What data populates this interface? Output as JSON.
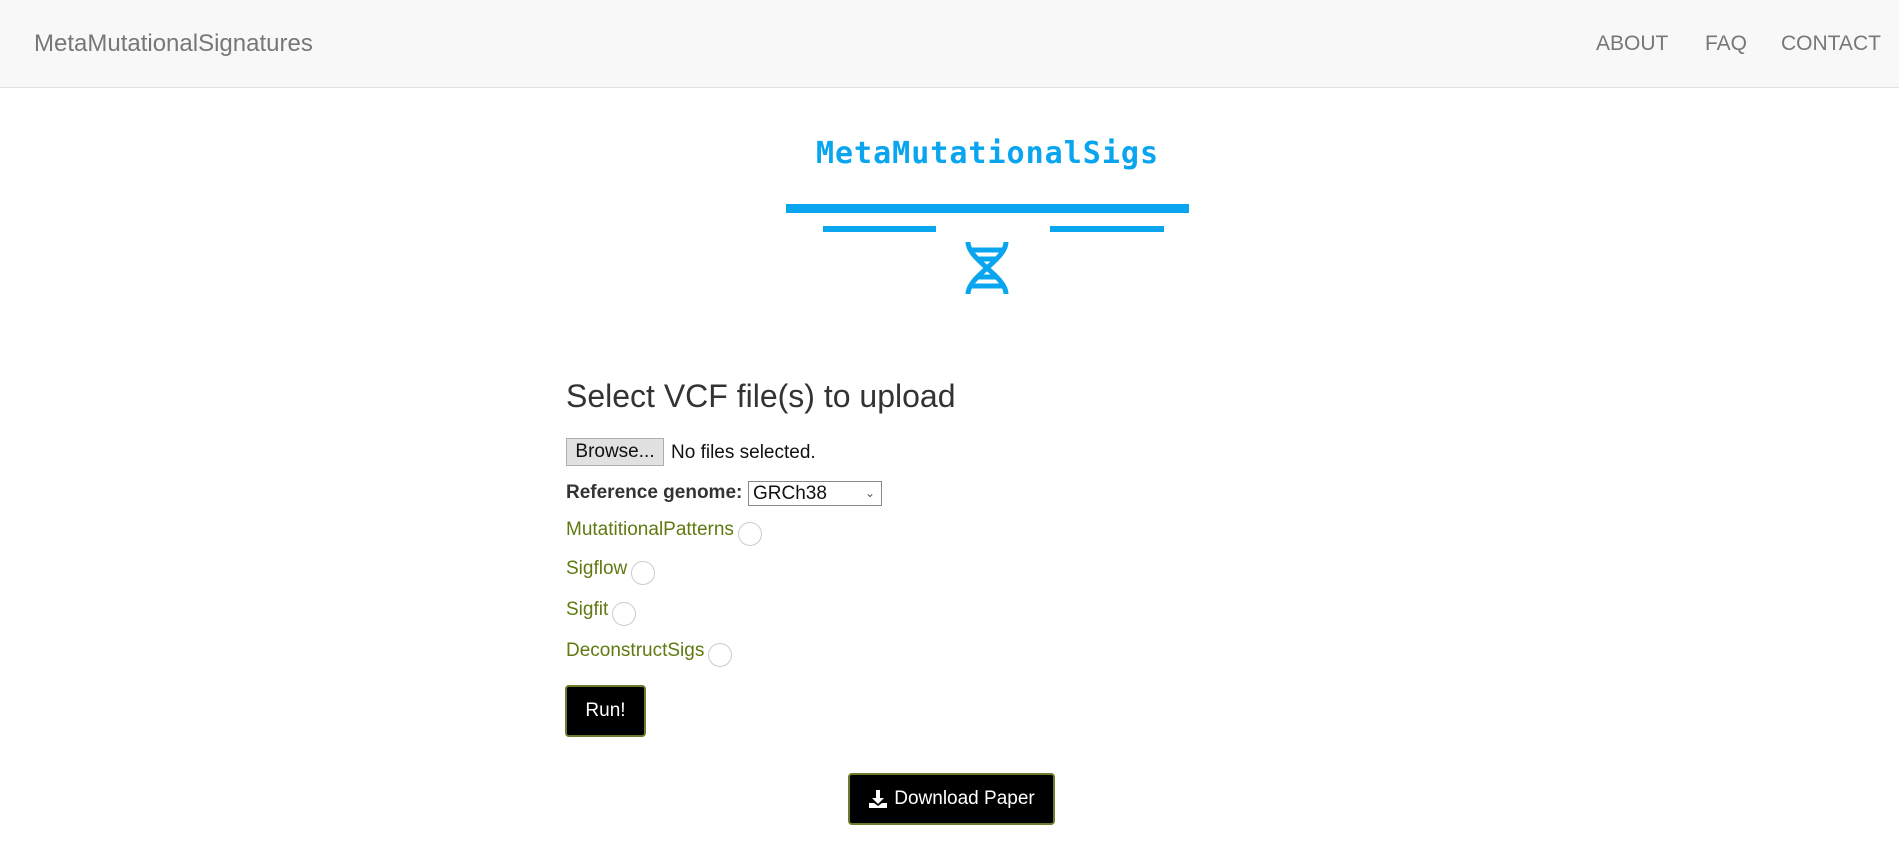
{
  "navbar": {
    "brand": "MetaMutationalSignatures",
    "links": [
      "ABOUT",
      "FAQ",
      "CONTACT"
    ]
  },
  "logo": {
    "text": "MetaMutationalSigs",
    "icon": "dna-icon",
    "color": "#0aa5ef"
  },
  "form": {
    "heading": "Select VCF file(s) to upload",
    "browse_label": "Browse...",
    "file_status": "No files selected.",
    "reference_label": "Reference genome:",
    "reference_value": "GRCh38",
    "tools": [
      "MutatitionalPatterns",
      "Sigflow",
      "Sigfit",
      "DeconstructSigs"
    ],
    "run_label": "Run!"
  },
  "download": {
    "label": "Download Paper",
    "icon": "download-icon"
  }
}
